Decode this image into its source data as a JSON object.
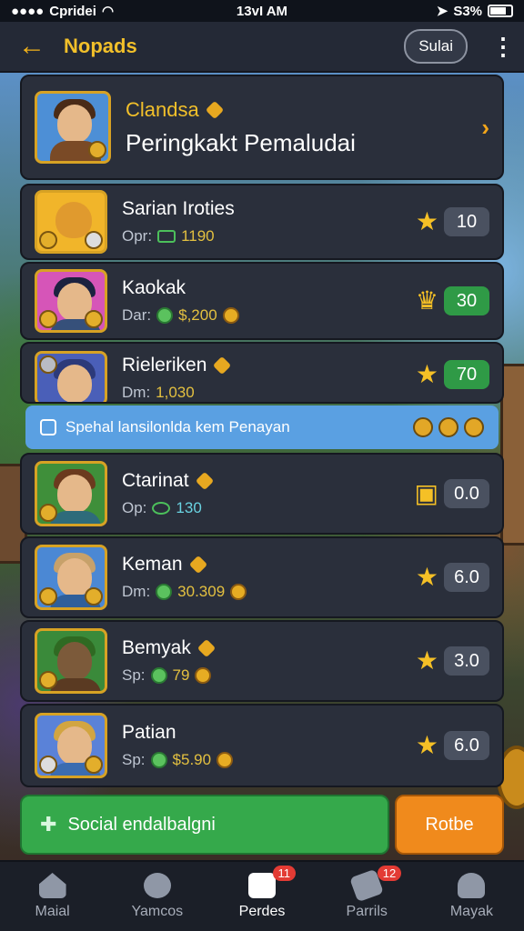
{
  "status_bar": {
    "carrier": "Cpridei",
    "time": "13vI AM",
    "battery": "S3%"
  },
  "header": {
    "back_icon": "back-arrow-icon",
    "title": "Nopads",
    "action_label": "Sulai",
    "more_icon": "more-vert-icon"
  },
  "featured": {
    "name": "Clandsa",
    "subtitle": "Peringkakt Pemaludai"
  },
  "rows": [
    {
      "name": "Sarian Iroties",
      "prefix": "Opr:",
      "amount": "1190",
      "score": "10",
      "score_style": "gray"
    },
    {
      "name": "Kaokak",
      "prefix": "Dar:",
      "amount": "$,200",
      "score": "30",
      "score_style": "green"
    },
    {
      "name": "Rieleriken",
      "prefix": "Dm:",
      "amount": "1,030",
      "score": "70",
      "score_style": "green"
    },
    {
      "name": "Ctarinat",
      "prefix": "Op:",
      "amount": "130",
      "score": "0.0",
      "score_style": "gray"
    },
    {
      "name": "Keman",
      "prefix": "Dm:",
      "amount": "30.309",
      "score": "6.0",
      "score_style": "gray"
    },
    {
      "name": "Bemyak",
      "prefix": "Sp:",
      "amount": "79",
      "score": "3.0",
      "score_style": "gray"
    },
    {
      "name": "Patian",
      "prefix": "Sp:",
      "amount": "$5.90",
      "score": "6.0",
      "score_style": "gray"
    }
  ],
  "banner": {
    "text": "Spehal lansilonlda kem Penayan"
  },
  "actions": {
    "social": "Social endalbalgni",
    "orange": "Rotbe"
  },
  "tabs": [
    {
      "label": "Maial",
      "badge": ""
    },
    {
      "label": "Yamcos",
      "badge": ""
    },
    {
      "label": "Perdes",
      "badge": "11"
    },
    {
      "label": "Parrils",
      "badge": "12"
    },
    {
      "label": "Mayak",
      "badge": ""
    }
  ],
  "colors": {
    "accent": "#f2b21a",
    "green": "#35a94b",
    "orange": "#f08a1c",
    "banner": "#5aa0e2"
  }
}
